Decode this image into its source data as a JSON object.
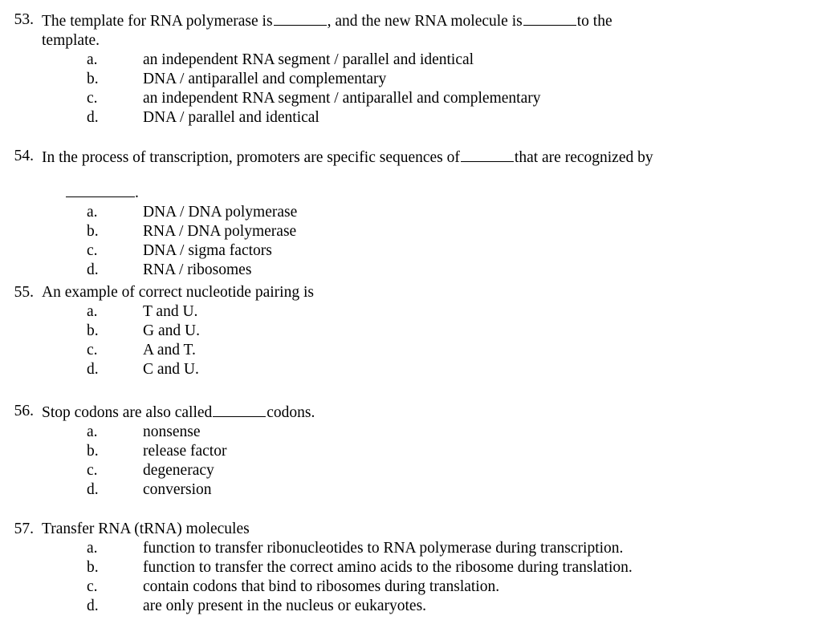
{
  "document": {
    "type": "multiple-choice-exam-page",
    "background_color": "#ffffff",
    "text_color": "#000000"
  },
  "questions": [
    {
      "number": "53.",
      "stem_part1": "The template for RNA polymerase is",
      "blank1": "",
      "stem_part2": ", and the new RNA molecule is",
      "blank2": "",
      "stem_part3": "to the",
      "stem_line2": "template.",
      "options": [
        {
          "letter": "a.",
          "text": "an independent RNA segment / parallel and identical"
        },
        {
          "letter": "b.",
          "text": "DNA / antiparallel and complementary"
        },
        {
          "letter": "c.",
          "text": "an independent RNA segment / antiparallel and complementary"
        },
        {
          "letter": "d.",
          "text": "DNA / parallel and identical"
        }
      ]
    },
    {
      "number": "54.",
      "stem_part1": "In the process of transcription, promoters are specific sequences of",
      "blank1": "",
      "stem_part2": "that are recognized by",
      "stem_line2_suffix": ".",
      "options": [
        {
          "letter": "a.",
          "text": "DNA / DNA polymerase"
        },
        {
          "letter": "b.",
          "text": "RNA / DNA polymerase"
        },
        {
          "letter": "c.",
          "text": "DNA / sigma factors"
        },
        {
          "letter": "d.",
          "text": "RNA / ribosomes"
        }
      ]
    },
    {
      "number": "55.",
      "stem_part1": "An example of correct nucleotide pairing is",
      "options": [
        {
          "letter": "a.",
          "text": "T and U."
        },
        {
          "letter": "b.",
          "text": "G and U."
        },
        {
          "letter": "c.",
          "text": "A and T."
        },
        {
          "letter": "d.",
          "text": "C and U."
        }
      ]
    },
    {
      "number": "56.",
      "stem_part1": "Stop codons are also called",
      "blank1": "",
      "stem_part2": "codons.",
      "options": [
        {
          "letter": "a.",
          "text": "nonsense"
        },
        {
          "letter": "b.",
          "text": "release factor"
        },
        {
          "letter": "c.",
          "text": "degeneracy"
        },
        {
          "letter": "d.",
          "text": "conversion"
        }
      ]
    },
    {
      "number": "57.",
      "stem_part1": "Transfer RNA (tRNA) molecules",
      "options": [
        {
          "letter": "a.",
          "text": "function to transfer ribonucleotides to RNA polymerase during transcription."
        },
        {
          "letter": "b.",
          "text": "function to transfer the correct amino acids to the ribosome during translation."
        },
        {
          "letter": "c.",
          "text": "contain codons that bind to ribosomes during translation."
        },
        {
          "letter": "d.",
          "text": "are only present in the nucleus or eukaryotes."
        }
      ]
    }
  ]
}
